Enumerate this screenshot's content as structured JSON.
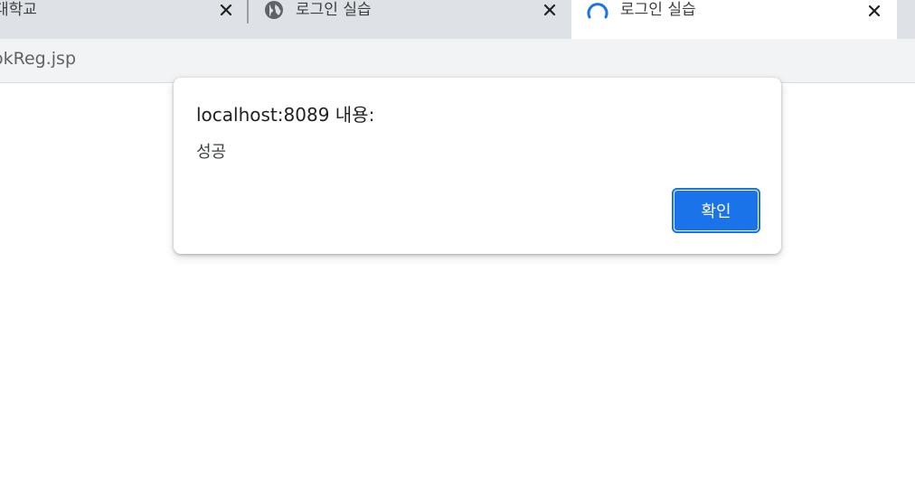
{
  "tabs": [
    {
      "title": "대학교",
      "active": false,
      "icon": null
    },
    {
      "title": "로그인 실습",
      "active": false,
      "icon": "globe-icon"
    },
    {
      "title": "로그인 실습",
      "active": true,
      "icon": "loading-spinner-icon"
    }
  ],
  "toolbar": {
    "url_fragment": "okReg.jsp"
  },
  "alert_dialog": {
    "title": "localhost:8089 내용:",
    "message": "성공",
    "ok_label": "확인"
  },
  "colors": {
    "tabstrip_bg": "#dee1e6",
    "toolbar_bg": "#f1f3f4",
    "accent_blue": "#1a73e8",
    "text_dark": "#202124"
  }
}
